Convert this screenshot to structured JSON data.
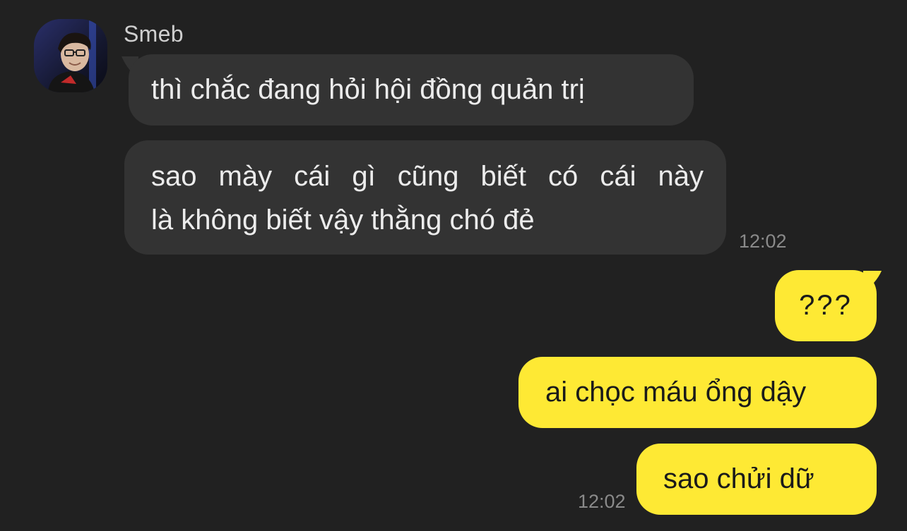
{
  "conversation": {
    "sender": {
      "name": "Smeb",
      "avatar_icon": "profile-photo-avatar"
    },
    "incoming": [
      {
        "lines": [
          "thì chắc đang hỏi hội đồng quản trị"
        ]
      },
      {
        "lines": [
          "sao mày cái gì cũng biết có cái này",
          "là không biết vậy thằng chó đẻ"
        ]
      }
    ],
    "incoming_time": "12:02",
    "outgoing": [
      {
        "text": "???"
      },
      {
        "text": "ai chọc máu ổng dậy"
      },
      {
        "text": "sao chửi dữ"
      }
    ],
    "outgoing_time": "12:02"
  },
  "colors": {
    "background": "#212121",
    "incoming_bubble": "#333333",
    "outgoing_bubble": "#fee934",
    "incoming_text": "#ececec",
    "outgoing_text": "#1a1a1a",
    "timestamp": "#8a8a8a"
  }
}
